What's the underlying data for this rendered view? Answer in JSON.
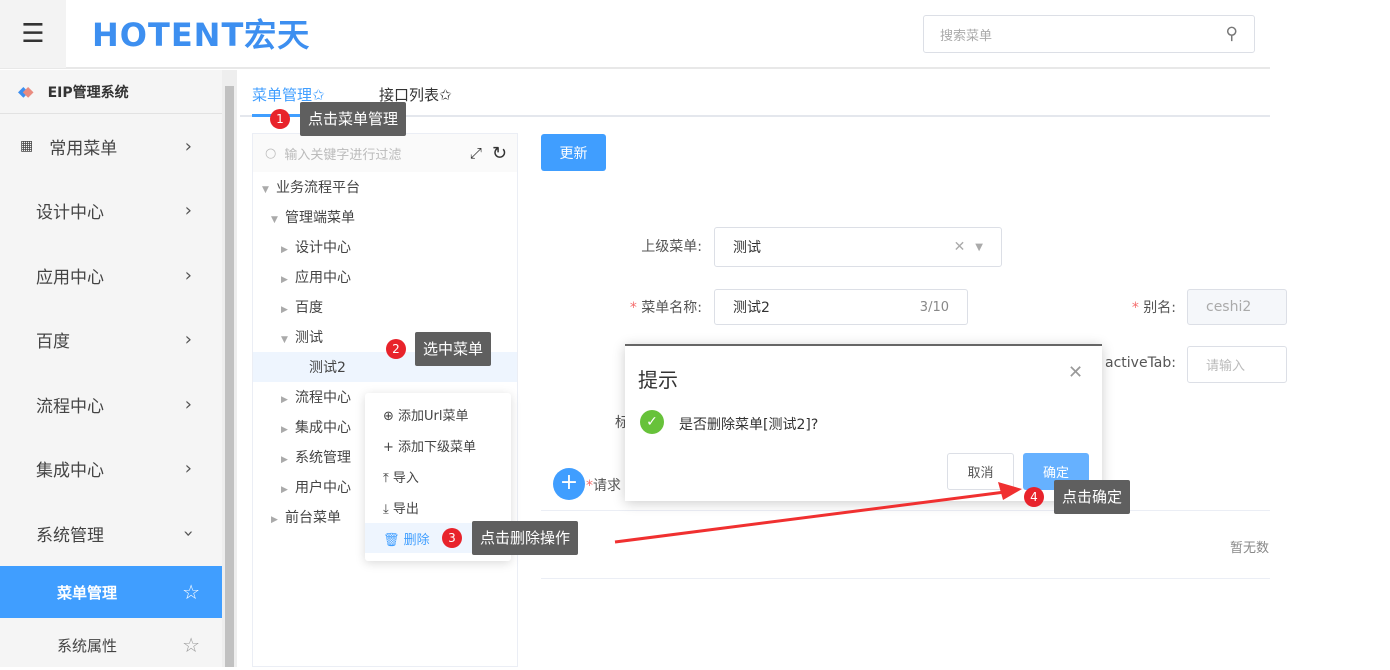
{
  "header": {
    "logo": "HOTENT宏天",
    "search_placeholder": "搜索菜单"
  },
  "sidebar": {
    "system": "EIP管理系统",
    "items": [
      {
        "label": "常用菜单"
      },
      {
        "label": "设计中心"
      },
      {
        "label": "应用中心"
      },
      {
        "label": "百度"
      },
      {
        "label": "流程中心"
      },
      {
        "label": "集成中心"
      },
      {
        "label": "系统管理"
      }
    ],
    "sub_items": [
      {
        "label": "菜单管理"
      },
      {
        "label": "系统属性"
      }
    ]
  },
  "tabs": [
    {
      "label": "菜单管理✩"
    },
    {
      "label": "接口列表✩"
    }
  ],
  "tree": {
    "filter_placeholder": "输入关键字进行过滤",
    "nodes": [
      "业务流程平台",
      "管理端菜单",
      "设计中心",
      "应用中心",
      "百度",
      "测试",
      "测试2",
      "流程中心",
      "集成中心",
      "系统管理",
      "用户中心",
      "前台菜单"
    ]
  },
  "context_menu": [
    "添加Url菜单",
    "添加下级菜单",
    "导入",
    "导出",
    "删除"
  ],
  "form": {
    "update_label": "更新",
    "parent_label": "上级菜单:",
    "parent_value": "测试",
    "name_label": "菜单名称:",
    "name_value": "测试2",
    "name_count": "3/10",
    "alias_label": "别名:",
    "alias_value": "ceshi2",
    "active_tab_label": "activeTab:",
    "active_tab_placeholder": "请输入",
    "partial_label": "标",
    "request_label": "请求",
    "empty_text": "暂无数"
  },
  "dialog": {
    "title": "提示",
    "message": "是否删除菜单[测试2]?",
    "cancel": "取消",
    "confirm": "确定"
  },
  "annotations": [
    {
      "num": "1",
      "text": "点击菜单管理"
    },
    {
      "num": "2",
      "text": "选中菜单"
    },
    {
      "num": "3",
      "text": "点击删除操作"
    },
    {
      "num": "4",
      "text": "点击确定"
    }
  ],
  "colors": {
    "primary": "#409eff",
    "badge": "#e8232b",
    "success": "#67c23a"
  }
}
